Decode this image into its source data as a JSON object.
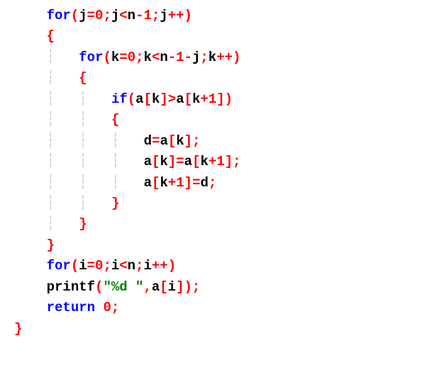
{
  "code": {
    "lines": [
      {
        "indent": 1,
        "s": [
          {
            "cls": "kw",
            "t": "for"
          },
          {
            "cls": "br",
            "t": "("
          },
          {
            "cls": "id",
            "t": "j"
          },
          {
            "cls": "op",
            "t": "="
          },
          {
            "cls": "num",
            "t": "0"
          },
          {
            "cls": "op",
            "t": ";"
          },
          {
            "cls": "id",
            "t": "j"
          },
          {
            "cls": "op",
            "t": "<"
          },
          {
            "cls": "id",
            "t": "n"
          },
          {
            "cls": "op",
            "t": "-"
          },
          {
            "cls": "num",
            "t": "1"
          },
          {
            "cls": "op",
            "t": ";"
          },
          {
            "cls": "id",
            "t": "j"
          },
          {
            "cls": "op",
            "t": "++)"
          }
        ]
      },
      {
        "indent": 1,
        "s": [
          {
            "cls": "br",
            "t": "{"
          }
        ]
      },
      {
        "indent": 2,
        "guides": [
          1
        ],
        "s": [
          {
            "cls": "kw",
            "t": "for"
          },
          {
            "cls": "br",
            "t": "("
          },
          {
            "cls": "id",
            "t": "k"
          },
          {
            "cls": "op",
            "t": "="
          },
          {
            "cls": "num",
            "t": "0"
          },
          {
            "cls": "op",
            "t": ";"
          },
          {
            "cls": "id",
            "t": "k"
          },
          {
            "cls": "op",
            "t": "<"
          },
          {
            "cls": "id",
            "t": "n"
          },
          {
            "cls": "op",
            "t": "-"
          },
          {
            "cls": "num",
            "t": "1"
          },
          {
            "cls": "op",
            "t": "-"
          },
          {
            "cls": "id",
            "t": "j"
          },
          {
            "cls": "op",
            "t": ";"
          },
          {
            "cls": "id",
            "t": "k"
          },
          {
            "cls": "op",
            "t": "++)"
          }
        ]
      },
      {
        "indent": 2,
        "guides": [
          1
        ],
        "s": [
          {
            "cls": "br",
            "t": "{"
          }
        ]
      },
      {
        "indent": 3,
        "guides": [
          1,
          2
        ],
        "s": [
          {
            "cls": "kw",
            "t": "if"
          },
          {
            "cls": "br",
            "t": "("
          },
          {
            "cls": "id",
            "t": "a"
          },
          {
            "cls": "br",
            "t": "["
          },
          {
            "cls": "id",
            "t": "k"
          },
          {
            "cls": "br",
            "t": "]"
          },
          {
            "cls": "op",
            "t": ">"
          },
          {
            "cls": "id",
            "t": "a"
          },
          {
            "cls": "br",
            "t": "["
          },
          {
            "cls": "id",
            "t": "k"
          },
          {
            "cls": "op",
            "t": "+"
          },
          {
            "cls": "num",
            "t": "1"
          },
          {
            "cls": "br",
            "t": "])"
          }
        ]
      },
      {
        "indent": 3,
        "guides": [
          1,
          2
        ],
        "s": [
          {
            "cls": "br",
            "t": "{"
          }
        ]
      },
      {
        "indent": 4,
        "guides": [
          1,
          2,
          3
        ],
        "s": [
          {
            "cls": "id",
            "t": "d"
          },
          {
            "cls": "op",
            "t": "="
          },
          {
            "cls": "id",
            "t": "a"
          },
          {
            "cls": "br",
            "t": "["
          },
          {
            "cls": "id",
            "t": "k"
          },
          {
            "cls": "br",
            "t": "]"
          },
          {
            "cls": "op",
            "t": ";"
          }
        ]
      },
      {
        "indent": 4,
        "guides": [
          1,
          2,
          3
        ],
        "s": [
          {
            "cls": "id",
            "t": "a"
          },
          {
            "cls": "br",
            "t": "["
          },
          {
            "cls": "id",
            "t": "k"
          },
          {
            "cls": "br",
            "t": "]"
          },
          {
            "cls": "op",
            "t": "="
          },
          {
            "cls": "id",
            "t": "a"
          },
          {
            "cls": "br",
            "t": "["
          },
          {
            "cls": "id",
            "t": "k"
          },
          {
            "cls": "op",
            "t": "+"
          },
          {
            "cls": "num",
            "t": "1"
          },
          {
            "cls": "br",
            "t": "]"
          },
          {
            "cls": "op",
            "t": ";"
          }
        ]
      },
      {
        "indent": 4,
        "guides": [
          1,
          2,
          3
        ],
        "s": [
          {
            "cls": "id",
            "t": "a"
          },
          {
            "cls": "br",
            "t": "["
          },
          {
            "cls": "id",
            "t": "k"
          },
          {
            "cls": "op",
            "t": "+"
          },
          {
            "cls": "num",
            "t": "1"
          },
          {
            "cls": "br",
            "t": "]"
          },
          {
            "cls": "op",
            "t": "="
          },
          {
            "cls": "id",
            "t": "d"
          },
          {
            "cls": "op",
            "t": ";"
          }
        ]
      },
      {
        "indent": 3,
        "guides": [
          1,
          2
        ],
        "s": [
          {
            "cls": "br",
            "t": "}"
          }
        ]
      },
      {
        "indent": 2,
        "guides": [
          1
        ],
        "s": [
          {
            "cls": "br",
            "t": "}"
          }
        ]
      },
      {
        "indent": 1,
        "s": [
          {
            "cls": "br",
            "t": "}"
          }
        ]
      },
      {
        "indent": 1,
        "s": [
          {
            "cls": "kw",
            "t": "for"
          },
          {
            "cls": "br",
            "t": "("
          },
          {
            "cls": "id",
            "t": "i"
          },
          {
            "cls": "op",
            "t": "="
          },
          {
            "cls": "num",
            "t": "0"
          },
          {
            "cls": "op",
            "t": ";"
          },
          {
            "cls": "id",
            "t": "i"
          },
          {
            "cls": "op",
            "t": "<"
          },
          {
            "cls": "id",
            "t": "n"
          },
          {
            "cls": "op",
            "t": ";"
          },
          {
            "cls": "id",
            "t": "i"
          },
          {
            "cls": "op",
            "t": "++)"
          }
        ]
      },
      {
        "indent": 1,
        "s": [
          {
            "cls": "id",
            "t": "printf"
          },
          {
            "cls": "br",
            "t": "("
          },
          {
            "cls": "str",
            "t": "\"%d \""
          },
          {
            "cls": "op",
            "t": ","
          },
          {
            "cls": "id",
            "t": "a"
          },
          {
            "cls": "br",
            "t": "["
          },
          {
            "cls": "id",
            "t": "i"
          },
          {
            "cls": "br",
            "t": "])"
          },
          {
            "cls": "op",
            "t": ";"
          }
        ]
      },
      {
        "indent": 1,
        "s": [
          {
            "cls": "kw",
            "t": "return"
          },
          {
            "cls": "id",
            "t": " "
          },
          {
            "cls": "num",
            "t": "0"
          },
          {
            "cls": "op",
            "t": ";"
          }
        ]
      },
      {
        "indent": 0,
        "s": [
          {
            "cls": "br",
            "t": "}"
          }
        ]
      }
    ]
  },
  "indent_unit": "    "
}
